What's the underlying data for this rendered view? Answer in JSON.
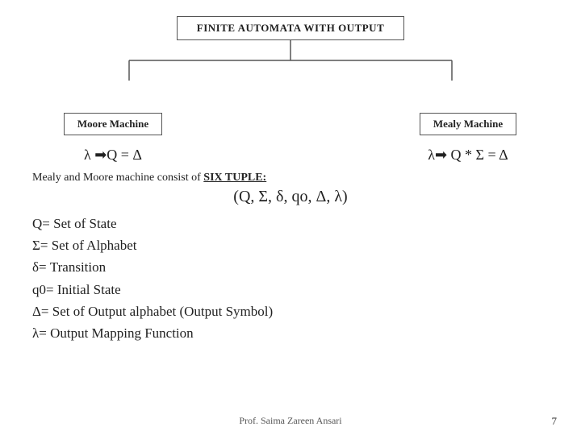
{
  "header": {
    "title": "FINITE AUTOMATA WITH OUTPUT"
  },
  "branches": {
    "left": {
      "label": "Moore Machine",
      "formula": "λ ➡ Q = Δ"
    },
    "right": {
      "label": "Mealy Machine",
      "formula": "λ➡ Q * Σ = Δ"
    }
  },
  "body": {
    "intro": "Mealy and Moore machine consist of",
    "intro_underline": "SIX TUPLE:",
    "tuple": "(Q, Σ, δ, qo, Δ, λ)",
    "definitions": [
      "Q= Set of State",
      "Σ= Set of Alphabet",
      "δ= Transition",
      "q0= Initial State",
      "Δ= Set of Output alphabet (Output Symbol)",
      "λ= Output Mapping Function"
    ]
  },
  "footer": {
    "author": "Prof. Saima Zareen Ansari",
    "page_number": "7"
  }
}
